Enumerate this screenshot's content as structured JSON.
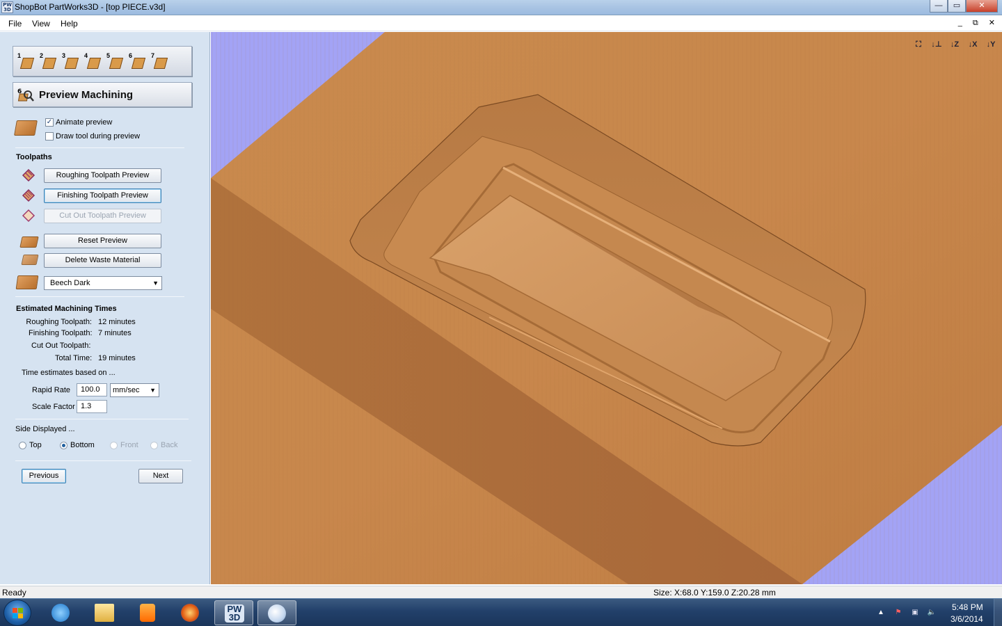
{
  "window": {
    "icon_text": "PW 3D",
    "title": "ShopBot PartWorks3D - [top PIECE.v3d]",
    "minimize": "—",
    "maximize": "▭",
    "close": "✕"
  },
  "menu": {
    "file": "File",
    "view": "View",
    "help": "Help",
    "mdi_controls": "_ ⧉ ✕"
  },
  "toolbar": {
    "steps": [
      {
        "num": "1",
        "icon": "model-size-icon"
      },
      {
        "num": "2",
        "icon": "position-model-icon"
      },
      {
        "num": "3",
        "icon": "roughing-toolpath-icon"
      },
      {
        "num": "4",
        "icon": "finishing-toolpath-icon"
      },
      {
        "num": "5",
        "icon": "cutout-toolpath-icon"
      },
      {
        "num": "6",
        "icon": "preview-machining-icon"
      },
      {
        "num": "7",
        "icon": "save-toolpath-icon"
      }
    ]
  },
  "panel": {
    "header_num": "6",
    "title": "Preview Machining",
    "animate_preview": {
      "label": "Animate preview",
      "checked": true
    },
    "draw_tool": {
      "label": "Draw tool during preview",
      "checked": false
    },
    "toolpaths_label": "Toolpaths",
    "roughing_btn": "Roughing Toolpath Preview",
    "finishing_btn": "Finishing Toolpath Preview",
    "cutout_btn": "Cut Out Toolpath Preview",
    "reset_btn": "Reset Preview",
    "delete_waste_btn": "Delete Waste Material",
    "material_select": "Beech Dark",
    "est_times_label": "Estimated Machining Times",
    "roughing_label": "Roughing Toolpath:",
    "roughing_value": "12 minutes",
    "finishing_label": "Finishing Toolpath:",
    "finishing_value": "7 minutes",
    "cutout_label": "Cut Out Toolpath:",
    "cutout_value": "",
    "total_label": "Total Time:",
    "total_value": "19 minutes",
    "based_on": "Time estimates based on ...",
    "rapid_rate_label": "Rapid Rate",
    "rapid_rate_value": "100.0",
    "rapid_rate_unit": "mm/sec",
    "scale_factor_label": "Scale Factor",
    "scale_factor_value": "1.3",
    "side_displayed_label": "Side Displayed ...",
    "sides": [
      {
        "label": "Top",
        "checked": false,
        "enabled": true
      },
      {
        "label": "Bottom",
        "checked": true,
        "enabled": true
      },
      {
        "label": "Front",
        "checked": false,
        "enabled": false
      },
      {
        "label": "Back",
        "checked": false,
        "enabled": false
      }
    ],
    "previous_btn": "Previous",
    "next_btn": "Next"
  },
  "viewport": {
    "background": "#a3a3f5",
    "wood_color": "#c98a4e",
    "view_buttons": [
      {
        "icon": "zoom-all-icon",
        "text": "⛶"
      },
      {
        "icon": "iso-view-icon",
        "text": "↓⊥"
      },
      {
        "icon": "view-z-icon",
        "text": "↓Z"
      },
      {
        "icon": "view-x-icon",
        "text": "↓X"
      },
      {
        "icon": "view-y-icon",
        "text": "↓Y"
      }
    ]
  },
  "status": {
    "left": "Ready",
    "right": "Size: X:68.0 Y:159.0 Z:20.28 mm"
  },
  "taskbar": {
    "apps": [
      "internet-explorer-icon",
      "windows-explorer-icon",
      "media-player-icon",
      "firefox-icon",
      "partworks3d-icon",
      "paint-icon"
    ],
    "active_app": "PW 3D",
    "time": "5:48 PM",
    "date": "3/6/2014"
  }
}
